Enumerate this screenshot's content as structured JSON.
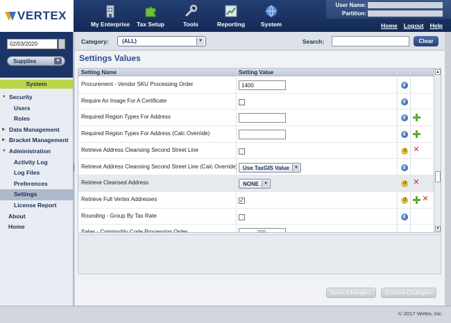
{
  "header": {
    "logo_text": "VERTEX",
    "nav": [
      {
        "label": "My Enterprise",
        "icon": "building-icon"
      },
      {
        "label": "Tax Setup",
        "icon": "puzzle-icon"
      },
      {
        "label": "Tools",
        "icon": "wrench-icon"
      },
      {
        "label": "Reporting",
        "icon": "chart-icon"
      },
      {
        "label": "System",
        "icon": "globe-icon"
      }
    ],
    "user_name_label": "User Name:",
    "partition_label": "Partition:",
    "links": {
      "home": "Home",
      "logout": "Logout",
      "help": "Help"
    }
  },
  "sidebar": {
    "date": "02/03/2020",
    "dropdown": "Supplies",
    "section": "System",
    "items": [
      {
        "label": "Security",
        "level": 0,
        "arrow": "▼"
      },
      {
        "label": "Users",
        "level": 2,
        "arrow": ""
      },
      {
        "label": "Roles",
        "level": 2,
        "arrow": ""
      },
      {
        "label": "Data Management",
        "level": 0,
        "arrow": "▶"
      },
      {
        "label": "Bracket Management",
        "level": 0,
        "arrow": "▶"
      },
      {
        "label": "Administration",
        "level": 0,
        "arrow": "▼"
      },
      {
        "label": "Activity Log",
        "level": 2,
        "arrow": ""
      },
      {
        "label": "Log Files",
        "level": 2,
        "arrow": ""
      },
      {
        "label": "Preferences",
        "level": 2,
        "arrow": ""
      },
      {
        "label": "Settings",
        "level": 2,
        "arrow": "",
        "active": true
      },
      {
        "label": "License Report",
        "level": 2,
        "arrow": ""
      },
      {
        "label": "About",
        "level": 1,
        "arrow": ""
      },
      {
        "label": "Home",
        "level": 1,
        "arrow": ""
      }
    ]
  },
  "filter": {
    "category_label": "Category:",
    "category_value": "(ALL)",
    "search_label": "Search:",
    "search_value": "",
    "clear_label": "Clear"
  },
  "main": {
    "title": "Settings Values",
    "columns": {
      "name": "Setting Name",
      "value": "Setting Value"
    },
    "rows": [
      {
        "name": "Procurement - Vendor SKU Processing Order",
        "type": "text",
        "value": "1400",
        "icons": [
          "info"
        ]
      },
      {
        "name": "Require An Image For A Certificate",
        "type": "checkbox",
        "checked": false,
        "icons": [
          "info"
        ]
      },
      {
        "name": "Required Region Types For Address",
        "type": "text",
        "value": "",
        "icons": [
          "info",
          "plus"
        ]
      },
      {
        "name": "Required Region Types For Address (Calc Override)",
        "type": "text",
        "value": "",
        "icons": [
          "info",
          "plus"
        ]
      },
      {
        "name": "Retrieve Address Cleansing Second Street Line",
        "type": "checkbox",
        "checked": false,
        "icons": [
          "undo",
          "x"
        ]
      },
      {
        "name": "Retrieve Address Cleansing Second Street Line (Calc Override)",
        "type": "select",
        "value": "Use TaxGIS Value",
        "icons": [
          "info"
        ]
      },
      {
        "name": "Retrieve Cleansed Address",
        "type": "select",
        "value": "NONE",
        "icons": [
          "undo",
          "x"
        ],
        "shaded": true
      },
      {
        "name": "Retrieve Full Vertex Addresses",
        "type": "checkbox",
        "checked": true,
        "icons": [
          "undo",
          "plus",
          "x"
        ]
      },
      {
        "name": "Rounding - Group By Tax Rate",
        "type": "checkbox",
        "checked": false,
        "icons": [
          "info"
        ]
      },
      {
        "name": "Sales - Commodity Code Processing Order",
        "type": "text",
        "value": "",
        "icons": []
      }
    ],
    "save_label": "Save Changes",
    "cancel_label": "Cancel Changes"
  },
  "footer": {
    "copyright": "© 2017 Vertex, Inc."
  },
  "colors": {
    "header": "#1b3566",
    "accent": "#bcd64a",
    "title": "#2b4f8a"
  }
}
